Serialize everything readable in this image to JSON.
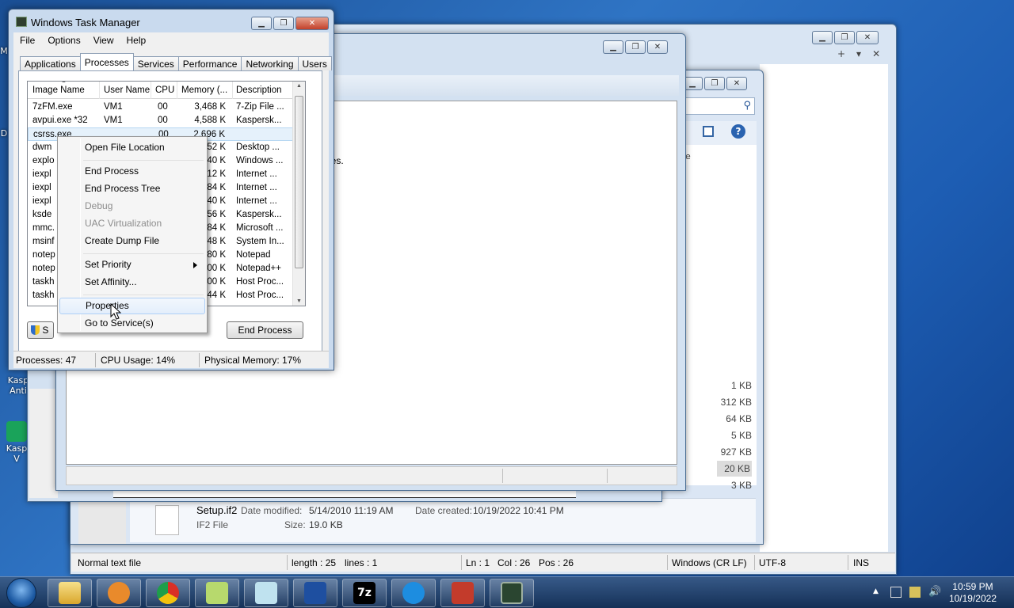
{
  "desktop": {
    "icons": [
      {
        "label": "M"
      },
      {
        "label": "D"
      },
      {
        "label": "Kasp Anti"
      },
      {
        "label": "Kasp V"
      }
    ]
  },
  "notepadpp": {
    "status": {
      "filetype": "Normal text file",
      "length": "length : 25",
      "lines": "lines : 1",
      "ln": "Ln : 1",
      "col": "Col : 26",
      "pos": "Pos : 26",
      "eol": "Windows (CR LF)",
      "encoding": "UTF-8",
      "mode": "INS"
    }
  },
  "dialog": {
    "partial_text": "cies."
  },
  "explorer": {
    "sizes": [
      "1 KB",
      "312 KB",
      "64 KB",
      "5 KB",
      "927 KB",
      "20 KB",
      "3 KB"
    ],
    "partial_header": "e",
    "details": {
      "filename": "Setup.if2",
      "modified_label": "Date modified:",
      "modified": "5/14/2010 11:19 AM",
      "created_label": "Date created:",
      "created": "10/19/2022 10:41 PM",
      "type": "IF2 File",
      "size_label": "Size:",
      "size": "19.0 KB"
    }
  },
  "taskmanager": {
    "title": "Windows Task Manager",
    "menu": [
      "File",
      "Options",
      "View",
      "Help"
    ],
    "tabs": [
      "Applications",
      "Processes",
      "Services",
      "Performance",
      "Networking",
      "Users"
    ],
    "active_tab": "Processes",
    "columns": [
      "Image Name",
      "User Name",
      "CPU",
      "Memory (...",
      "Description"
    ],
    "rows": [
      {
        "name": "7zFM.exe",
        "user": "VM1",
        "cpu": "00",
        "mem": "3,468 K",
        "desc": "7-Zip File ..."
      },
      {
        "name": "avpui.exe *32",
        "user": "VM1",
        "cpu": "00",
        "mem": "4,588 K",
        "desc": "Kaspersk..."
      },
      {
        "name": "csrss.exe",
        "user": "",
        "cpu": "00",
        "mem": "2,696 K",
        "desc": ""
      },
      {
        "name": "dwm",
        "user": "",
        "cpu": "",
        "mem": ",952 K",
        "desc": "Desktop ..."
      },
      {
        "name": "explo",
        "user": "",
        "cpu": "",
        "mem": ",340 K",
        "desc": "Windows ..."
      },
      {
        "name": "iexpl",
        "user": "",
        "cpu": "",
        "mem": ",112 K",
        "desc": "Internet ..."
      },
      {
        "name": "iexpl",
        "user": "",
        "cpu": "",
        "mem": ",584 K",
        "desc": "Internet ..."
      },
      {
        "name": "iexpl",
        "user": "",
        "cpu": "",
        "mem": ",640 K",
        "desc": "Internet ..."
      },
      {
        "name": "ksde",
        "user": "",
        "cpu": "",
        "mem": ",356 K",
        "desc": "Kaspersk..."
      },
      {
        "name": "mmc.",
        "user": "",
        "cpu": "",
        "mem": ",584 K",
        "desc": "Microsoft ..."
      },
      {
        "name": "msinf",
        "user": "",
        "cpu": "",
        "mem": ",748 K",
        "desc": "System In..."
      },
      {
        "name": "notep",
        "user": "",
        "cpu": "",
        "mem": ",980 K",
        "desc": "Notepad"
      },
      {
        "name": "notep",
        "user": "",
        "cpu": "",
        "mem": ",600 K",
        "desc": "Notepad++"
      },
      {
        "name": "taskh",
        "user": "",
        "cpu": "",
        "mem": ",200 K",
        "desc": "Host Proc..."
      },
      {
        "name": "taskh",
        "user": "",
        "cpu": "",
        "mem": ",144 K",
        "desc": "Host Proc..."
      }
    ],
    "show_all_label": "S",
    "end_process": "End Process",
    "status": {
      "processes": "Processes: 47",
      "cpu": "CPU Usage: 14%",
      "memory": "Physical Memory: 17%"
    }
  },
  "context_menu": {
    "items": [
      {
        "label": "Open File Location",
        "enabled": true
      },
      {
        "label": "End Process",
        "enabled": true
      },
      {
        "label": "End Process Tree",
        "enabled": true
      },
      {
        "label": "Debug",
        "enabled": false
      },
      {
        "label": "UAC Virtualization",
        "enabled": false
      },
      {
        "label": "Create Dump File",
        "enabled": true
      },
      {
        "label": "Set Priority",
        "enabled": true,
        "submenu": true
      },
      {
        "label": "Set Affinity...",
        "enabled": true
      },
      {
        "label": "Properties",
        "enabled": true,
        "hovered": true
      },
      {
        "label": "Go to Service(s)",
        "enabled": true
      }
    ]
  },
  "taskbar": {
    "start": "start-orb-icon",
    "apps": [
      "folder-icon",
      "media-player-icon",
      "chrome-icon",
      "notepadpp-icon",
      "notepad-icon",
      "msinfo-icon",
      "7zip-icon",
      "ie-icon",
      "toolbox-icon",
      "task-manager-icon"
    ],
    "time": "10:59 PM",
    "date": "10/19/2022"
  }
}
